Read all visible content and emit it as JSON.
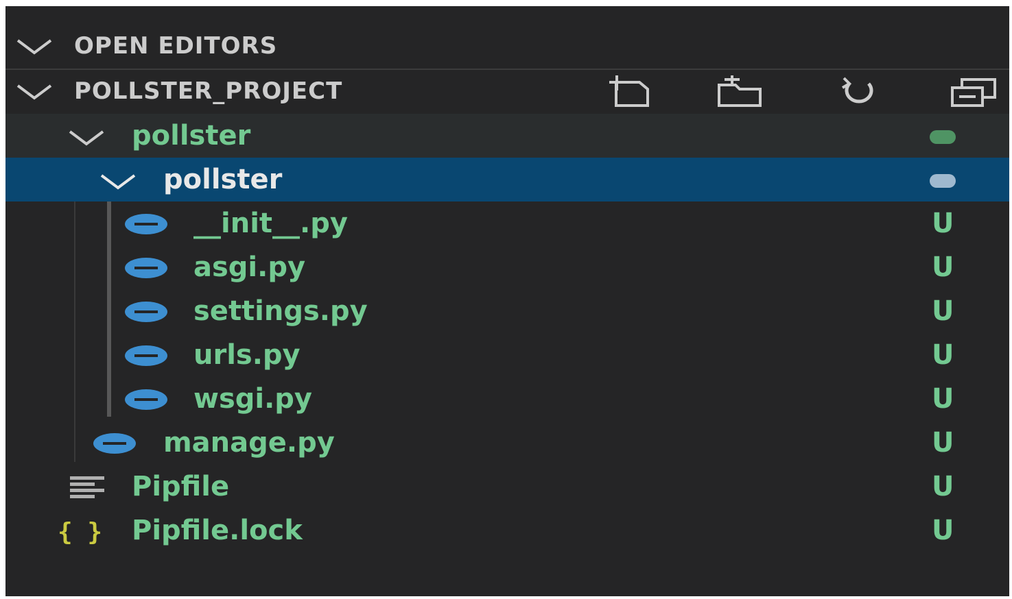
{
  "colors": {
    "background": "#252526",
    "selected_row": "#094771",
    "hover_row": "#2a2d2e",
    "untracked_green": "#73c991",
    "python_icon": "#3d8fd1",
    "json_icon": "#cbcb41"
  },
  "explorer": {
    "open_editors": {
      "title": "OPEN EDITORS",
      "expanded": true
    },
    "project": {
      "title": "POLLSTER_PROJECT",
      "expanded": true,
      "toolbar": [
        {
          "icon": "new-file-icon"
        },
        {
          "icon": "new-folder-icon"
        },
        {
          "icon": "refresh-icon"
        },
        {
          "icon": "collapse-all-icon"
        }
      ]
    },
    "tree": {
      "outer_folder": {
        "name": "pollster",
        "expanded": true
      },
      "inner_folder": {
        "name": "pollster",
        "expanded": true,
        "selected": true
      },
      "inner_files": [
        {
          "name": "__init__.py",
          "icon": "python-icon",
          "status": "U"
        },
        {
          "name": "asgi.py",
          "icon": "python-icon",
          "status": "U"
        },
        {
          "name": "settings.py",
          "icon": "python-icon",
          "status": "U"
        },
        {
          "name": "urls.py",
          "icon": "python-icon",
          "status": "U"
        },
        {
          "name": "wsgi.py",
          "icon": "python-icon",
          "status": "U"
        }
      ],
      "manage": {
        "name": "manage.py",
        "icon": "python-icon",
        "status": "U"
      },
      "root_files": [
        {
          "name": "Pipfile",
          "icon": "lines-file-icon",
          "status": "U"
        },
        {
          "name": "Pipfile.lock",
          "icon": "json-braces-icon",
          "status": "U"
        }
      ]
    }
  }
}
